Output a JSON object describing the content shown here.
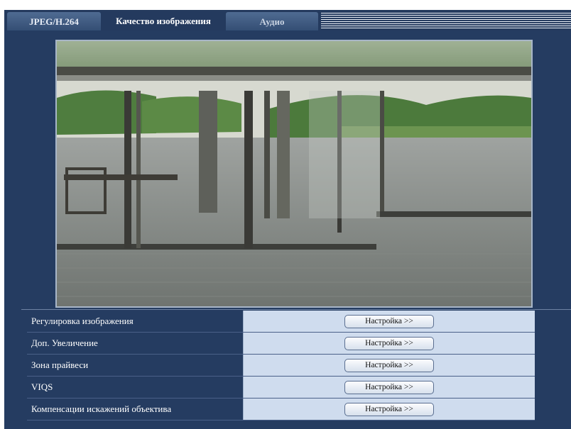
{
  "tabs": [
    {
      "label": "JPEG/H.264",
      "active": false
    },
    {
      "label": "Качество изображения",
      "active": true
    },
    {
      "label": "Аудио",
      "active": false
    }
  ],
  "settings": [
    {
      "label": "Регулировка изображения",
      "button": "Настройка >>"
    },
    {
      "label": "Доп. Увеличение",
      "button": "Настройка >>"
    },
    {
      "label": "Зона прайвеси",
      "button": "Настройка >>"
    },
    {
      "label": "VIQS",
      "button": "Настройка >>"
    },
    {
      "label": "Компенсации искажений объектива",
      "button": "Настройка >>"
    }
  ],
  "colors": {
    "panel": "#253c61",
    "value_cell": "#cfdcee",
    "tab_active": "#243a5e"
  }
}
